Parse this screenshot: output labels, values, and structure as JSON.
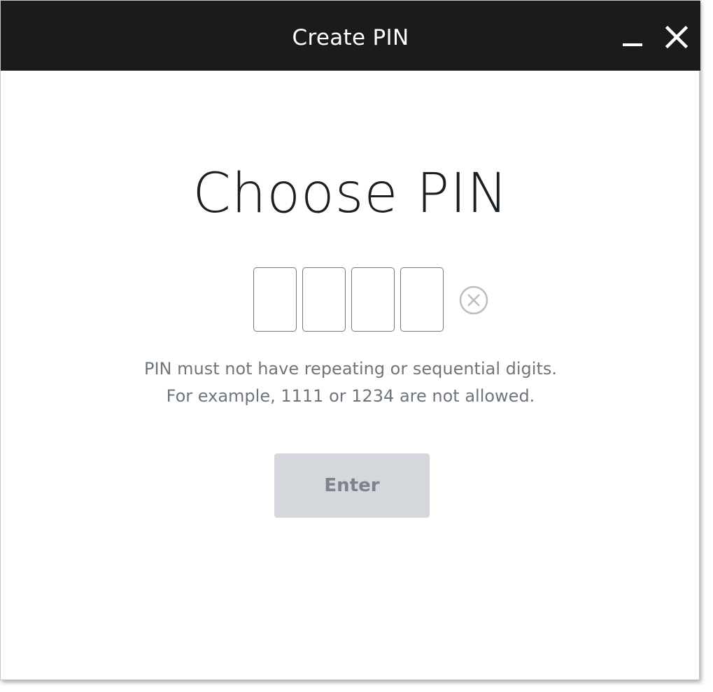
{
  "window": {
    "title": "Create PIN"
  },
  "main": {
    "heading": "Choose PIN",
    "pin_digits": [
      "",
      "",
      "",
      ""
    ],
    "hint_line1": "PIN must not have repeating or sequential digits.",
    "hint_line2": "For example, 1111 or 1234 are not allowed.",
    "enter_label": "Enter"
  },
  "icons": {
    "minimize": "minimize-icon",
    "close": "close-icon",
    "clear": "clear-circle-x-icon"
  },
  "colors": {
    "titlebar": "#1b1b1b",
    "button_disabled": "#d4d7dc",
    "hint_text": "#6e757c"
  }
}
